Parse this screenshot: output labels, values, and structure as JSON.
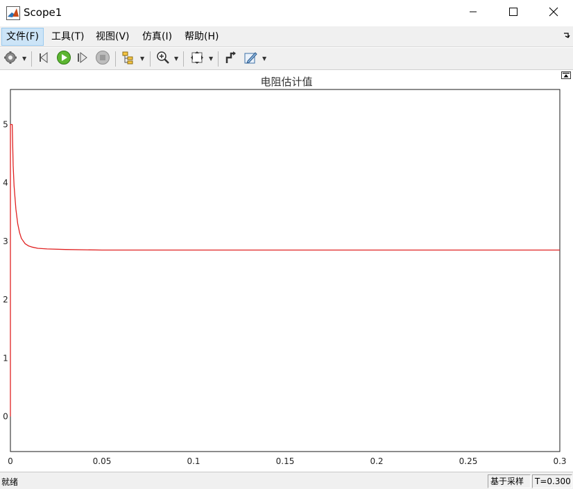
{
  "window": {
    "title": "Scope1",
    "icons": {
      "app": "matlab-logo-icon",
      "minimize": "minimize-icon",
      "maximize": "maximize-icon",
      "close": "close-icon"
    }
  },
  "menu": {
    "items": [
      {
        "label": "文件(F)",
        "active": true
      },
      {
        "label": "工具(T)"
      },
      {
        "label": "视图(V)"
      },
      {
        "label": "仿真(I)"
      },
      {
        "label": "帮助(H)"
      }
    ],
    "collapse_icon": "undock-arrow-icon"
  },
  "toolbar": {
    "buttons": [
      {
        "icon": "gear-icon",
        "dropdown": true
      },
      {
        "icon": "step-back-icon"
      },
      {
        "icon": "run-icon"
      },
      {
        "icon": "step-forward-icon"
      },
      {
        "icon": "stop-icon"
      },
      {
        "icon": "signal-hierarchy-icon",
        "dropdown": true
      },
      {
        "icon": "zoom-in-icon",
        "dropdown": true
      },
      {
        "icon": "fit-to-view-icon"
      },
      {
        "icon": "cursor-measurements-icon"
      },
      {
        "icon": "style-edit-icon",
        "dropdown": true
      }
    ]
  },
  "plot": {
    "restore_icon": "restore-layout-icon"
  },
  "chart_data": {
    "type": "line",
    "title": "电阻估计值",
    "xlabel": "",
    "ylabel": "",
    "xlim": [
      0,
      0.3
    ],
    "ylim": [
      -0.6,
      5.6
    ],
    "xticks": [
      0,
      0.05,
      0.1,
      0.15,
      0.2,
      0.25,
      0.3
    ],
    "xtick_labels": [
      "0",
      "0.05",
      "0.1",
      "0.15",
      "0.2",
      "0.25",
      "0.3"
    ],
    "yticks": [
      0,
      1,
      2,
      3,
      4,
      5
    ],
    "ytick_labels": [
      "0",
      "1",
      "2",
      "3",
      "4",
      "5"
    ],
    "grid": true,
    "background": "#ffffff",
    "grid_color": "#262626",
    "series": [
      {
        "color": "#e02020",
        "x": [
          0,
          0,
          0.0005,
          0.001,
          0.0015,
          0.002,
          0.003,
          0.004,
          0.005,
          0.006,
          0.008,
          0.01,
          0.012,
          0.015,
          0.02,
          0.03,
          0.05,
          0.1,
          0.15,
          0.2,
          0.25,
          0.3
        ],
        "y": [
          0,
          5.0,
          5.0,
          5.0,
          4.3,
          3.95,
          3.55,
          3.3,
          3.15,
          3.05,
          2.96,
          2.92,
          2.9,
          2.88,
          2.87,
          2.86,
          2.85,
          2.85,
          2.85,
          2.85,
          2.85,
          2.85
        ]
      }
    ]
  },
  "status": {
    "text": "就绪",
    "sample_mode": "基于采样",
    "time": "T=0.300"
  }
}
